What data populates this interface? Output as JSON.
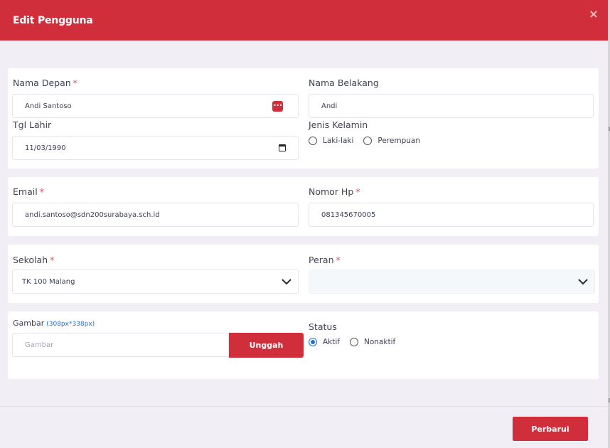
{
  "modal": {
    "title": "Edit Pengguna",
    "close_label": "×",
    "submit_label": "Perbarui"
  },
  "form": {
    "first_name": {
      "label": "Nama Depan",
      "required": "*",
      "value": "Andi Santoso"
    },
    "last_name": {
      "label": "Nama Belakang",
      "value": "Andi"
    },
    "birth_date": {
      "label": "Tgl Lahir",
      "value": "11/03/1990"
    },
    "gender": {
      "label": "Jenis Kelamin",
      "options": [
        "Laki-laki",
        "Perempuan"
      ],
      "selected": ""
    },
    "email": {
      "label": "Email",
      "required": "*",
      "value": "andi.santoso@sdn200surabaya.sch.id"
    },
    "phone": {
      "label": "Nomor Hp",
      "required": "*",
      "value": "081345670005"
    },
    "school": {
      "label": "Sekolah",
      "required": "*",
      "value": "TK 100 Malang"
    },
    "role": {
      "label": "Peran",
      "required": "*",
      "value": ""
    },
    "image": {
      "label": "Gambar",
      "hint": "(308px*338px)",
      "placeholder": "Gambar",
      "button_label": "Unggah"
    },
    "status": {
      "label": "Status",
      "options": [
        "Aktif",
        "Nonaktif"
      ],
      "selected": "Aktif"
    }
  },
  "icons": {
    "close": "close-icon",
    "password_manager": "key-icon",
    "calendar": "calendar-icon",
    "dropdown": "chevron-down-icon"
  },
  "colors": {
    "primary": "#d12e3c",
    "background": "#f1eff5",
    "link": "#1e73e8",
    "radio_checked": "#1e6fd6"
  }
}
